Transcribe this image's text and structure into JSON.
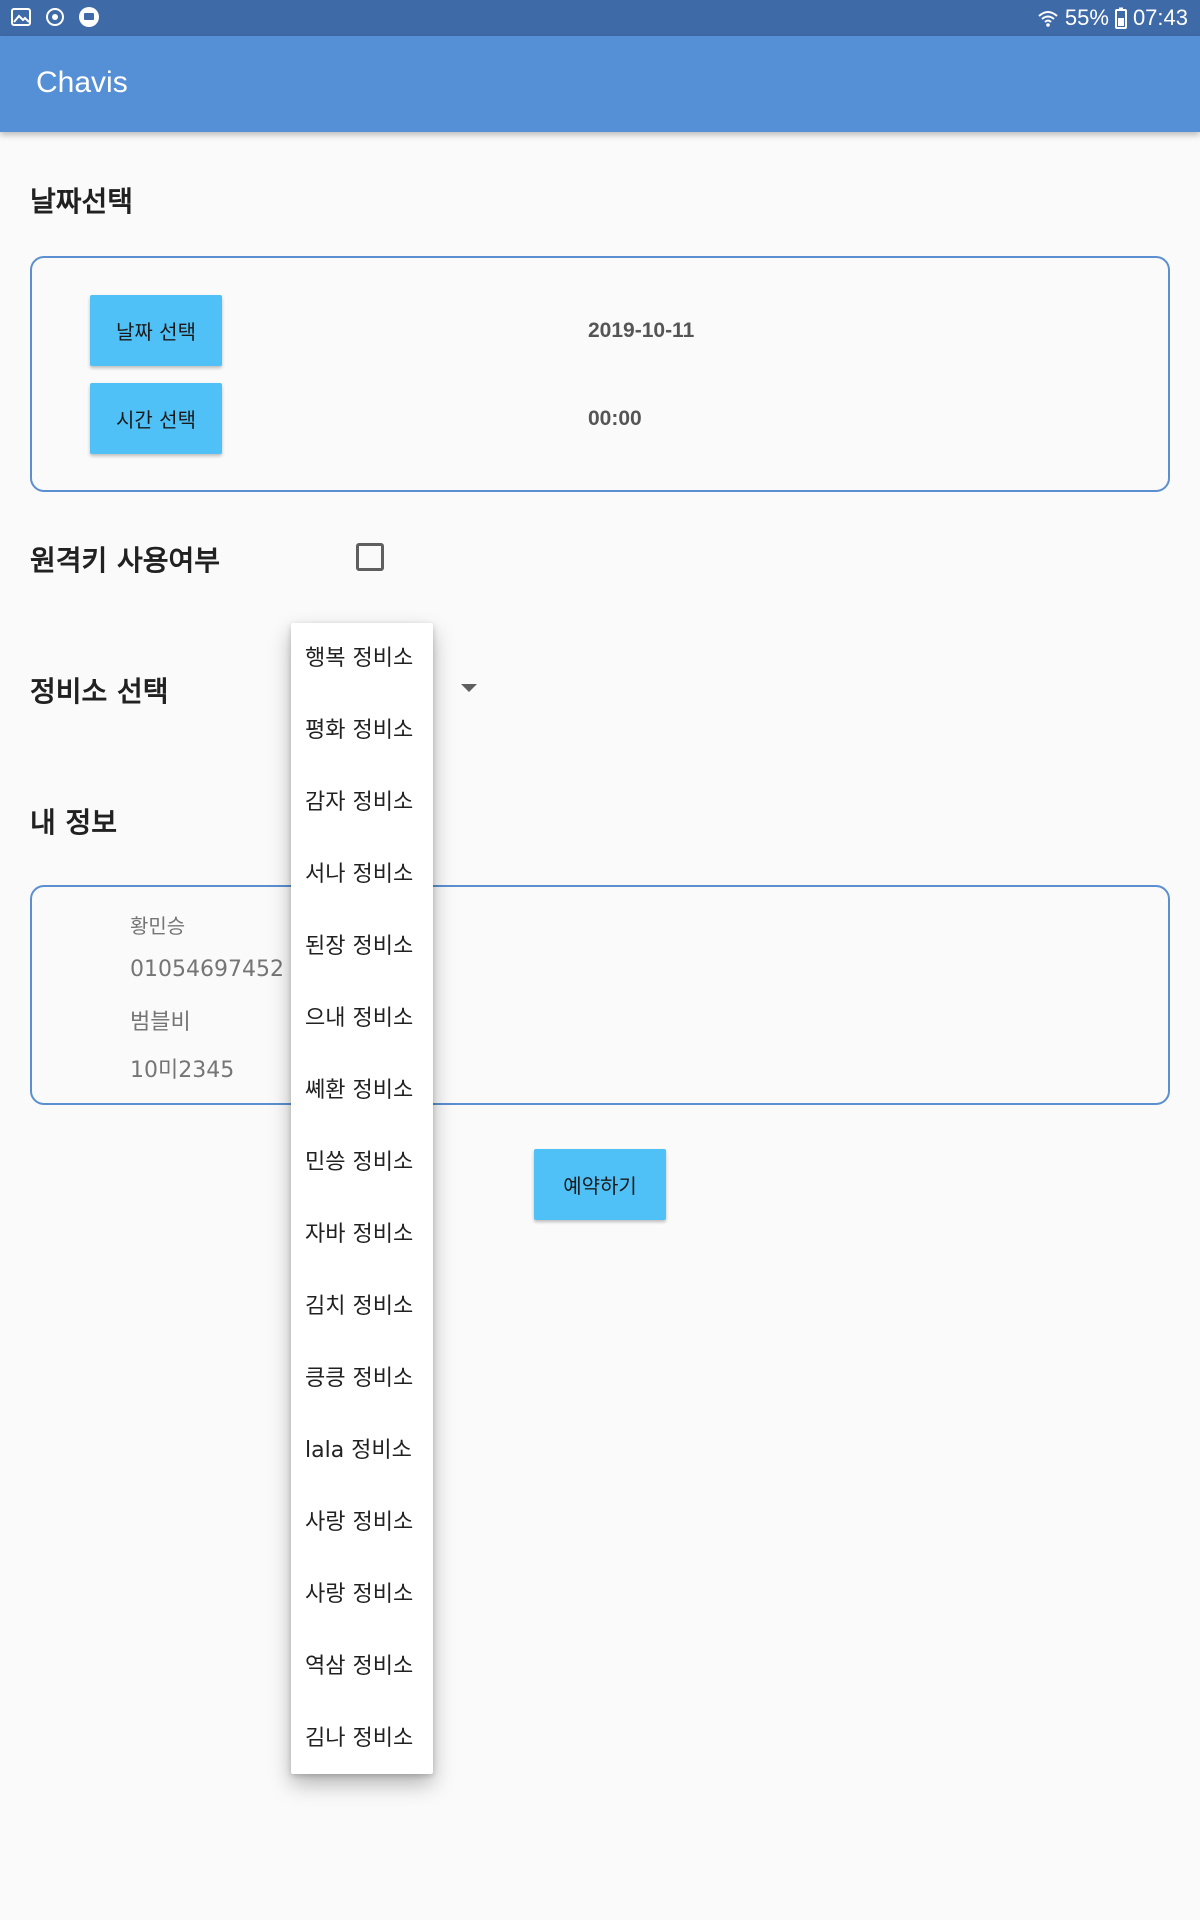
{
  "status_bar": {
    "icons_left": [
      "image-icon",
      "signal-app-icon",
      "message-app-icon"
    ],
    "wifi_icon": "wifi-icon",
    "battery_icon": "battery-icon",
    "battery": "55%",
    "time": "07:43"
  },
  "app_bar": {
    "title": "Chavis"
  },
  "date_section": {
    "title": "날짜선택",
    "date_button": "날짜 선택",
    "date_value": "2019-10-11",
    "time_button": "시간 선택",
    "time_value": "00:00"
  },
  "remote_key": {
    "label": "원격키 사용여부",
    "checked": false
  },
  "shop_section": {
    "label": "정비소 선택",
    "options": [
      "행복 정비소",
      "평화 정비소",
      "감자 정비소",
      "서나 정비소",
      "된장 정비소",
      "으내 정비소",
      "쎼환 정비소",
      "민씅 정비소",
      "자바 정비소",
      "김치 정비소",
      "킁킁 정비소",
      "lala 정비소",
      "사랑 정비소",
      "사랑 정비소",
      "역삼 정비소",
      "김나 정비소"
    ]
  },
  "my_info": {
    "title": "내 정보",
    "name": "황민승",
    "phone": "01054697452",
    "car_model": "범블비",
    "plate": "10미2345"
  },
  "reserve_button": "예약하기",
  "colors": {
    "status_bar": "#3f6aa8",
    "app_bar": "#558fd6",
    "button": "#4fc1f6",
    "card_border": "#5b8fd0"
  }
}
